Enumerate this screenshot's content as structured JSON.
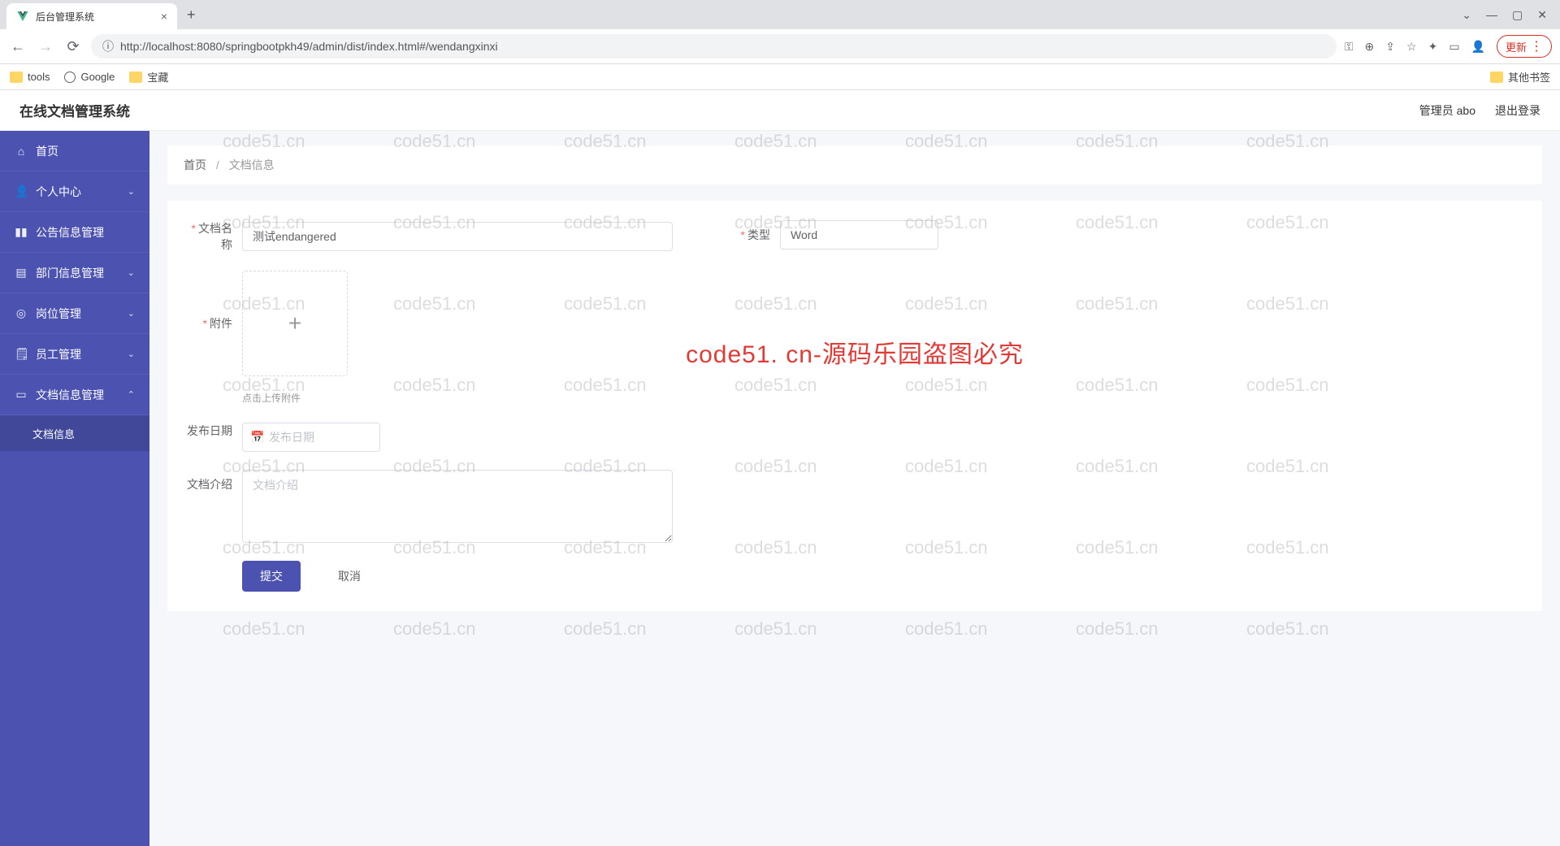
{
  "browser": {
    "tab_title": "后台管理系统",
    "url": "http://localhost:8080/springbootpkh49/admin/dist/index.html#/wendangxinxi",
    "update_label": "更新",
    "bookmarks": {
      "tools": "tools",
      "google": "Google",
      "treasure": "宝藏",
      "other": "其他书签"
    }
  },
  "header": {
    "app_title": "在线文档管理系统",
    "user_label": "管理员 abo",
    "logout_label": "退出登录"
  },
  "sidebar": {
    "home": "首页",
    "personal": "个人中心",
    "announcement": "公告信息管理",
    "department": "部门信息管理",
    "position": "岗位管理",
    "employee": "员工管理",
    "document": "文档信息管理",
    "document_sub": "文档信息"
  },
  "breadcrumb": {
    "home": "首页",
    "current": "文档信息"
  },
  "form": {
    "doc_name_label": "文档名称",
    "doc_name_value": "测试endangered",
    "type_label": "类型",
    "type_value": "Word",
    "attachment_label": "附件",
    "upload_tip": "点击上传附件",
    "publish_date_label": "发布日期",
    "publish_date_placeholder": "发布日期",
    "intro_label": "文档介绍",
    "intro_placeholder": "文档介绍",
    "submit": "提交",
    "cancel": "取消"
  },
  "watermark": {
    "text": "code51.cn",
    "red": "code51. cn-源码乐园盗图必究"
  }
}
